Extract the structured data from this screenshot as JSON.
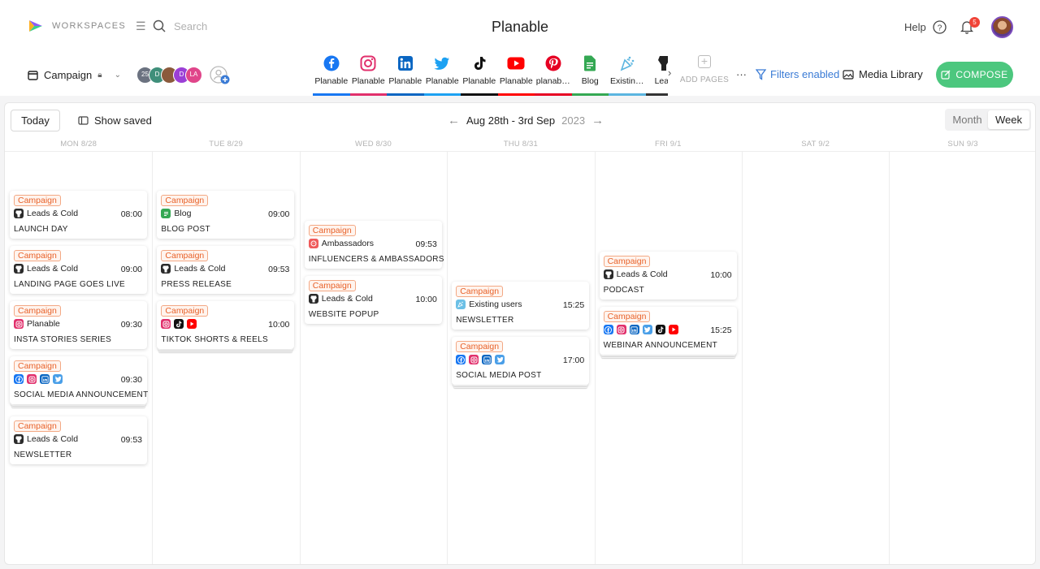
{
  "header": {
    "workspaces_label": "WORKSPACES",
    "search_placeholder": "Search",
    "app_title": "Planable",
    "help_label": "Help",
    "notification_count": "5"
  },
  "toolbar": {
    "campaign_label": "Campaign",
    "avatars": [
      {
        "text": "25",
        "color": "#6b7280"
      },
      {
        "text": "D",
        "color": "#3f8f7a"
      },
      {
        "text": "",
        "color": "#8b5a3c"
      },
      {
        "text": "D",
        "color": "#9b3fd6"
      },
      {
        "text": "LA",
        "color": "#e0458a"
      }
    ],
    "pages": [
      {
        "label": "Planable",
        "icon": "facebook-icon",
        "color": "#1877f2"
      },
      {
        "label": "Planable",
        "icon": "instagram-icon",
        "color": "#e1306c"
      },
      {
        "label": "Planable",
        "icon": "linkedin-icon",
        "color": "#0a66c2"
      },
      {
        "label": "Planable",
        "icon": "twitter-icon",
        "color": "#1da1f2"
      },
      {
        "label": "Planable",
        "icon": "tiktok-icon",
        "color": "#111111"
      },
      {
        "label": "Planable",
        "icon": "youtube-icon",
        "color": "#ff0000"
      },
      {
        "label": "planab…",
        "icon": "pinterest-icon",
        "color": "#e60023"
      },
      {
        "label": "Blog",
        "icon": "blog-icon",
        "color": "#34a853"
      },
      {
        "label": "Existin…",
        "icon": "existing-users-icon",
        "color": "#5bb5e0"
      },
      {
        "label": "Lead",
        "icon": "leads-icon",
        "color": "#333333"
      }
    ],
    "add_pages_label": "ADD PAGES",
    "more_label": "···",
    "filters_label": "Filters enabled",
    "media_library_label": "Media Library",
    "compose_label": "COMPOSE"
  },
  "calendar": {
    "today_label": "Today",
    "show_saved_label": "Show saved",
    "range_label": "Aug 28th - 3rd Sep",
    "range_year": "2023",
    "view_month": "Month",
    "view_week": "Week",
    "days": [
      "MON 8/28",
      "TUE 8/29",
      "WED 8/30",
      "THU 8/31",
      "FRI 9/1",
      "SAT 9/2",
      "SUN 9/3"
    ]
  },
  "posts": [
    {
      "day": 0,
      "tag": "Campaign",
      "account": "Leads & Cold",
      "icons": [
        "leads"
      ],
      "time": "08:00",
      "title": "LAUNCH DAY"
    },
    {
      "day": 0,
      "tag": "Campaign",
      "account": "Leads & Cold",
      "icons": [
        "leads"
      ],
      "time": "09:00",
      "title": "LANDING PAGE GOES LIVE"
    },
    {
      "day": 0,
      "tag": "Campaign",
      "account": "Planable",
      "icons": [
        "instagram"
      ],
      "time": "09:30",
      "title": "INSTA STORIES SERIES"
    },
    {
      "day": 0,
      "tag": "Campaign",
      "account": "",
      "icons": [
        "facebook",
        "instagram",
        "linkedin",
        "twitter"
      ],
      "time": "09:30",
      "title": "SOCIAL MEDIA ANNOUNCEMENT"
    },
    {
      "day": 0,
      "tag": "Campaign",
      "account": "Leads & Cold",
      "icons": [
        "leads"
      ],
      "time": "09:53",
      "title": "NEWSLETTER"
    },
    {
      "day": 1,
      "tag": "Campaign",
      "account": "Blog",
      "icons": [
        "blog"
      ],
      "time": "09:00",
      "title": "BLOG POST"
    },
    {
      "day": 1,
      "tag": "Campaign",
      "account": "Leads & Cold",
      "icons": [
        "leads"
      ],
      "time": "09:53",
      "title": "PRESS RELEASE"
    },
    {
      "day": 1,
      "tag": "Campaign",
      "account": "",
      "icons": [
        "instagram",
        "tiktok",
        "youtube"
      ],
      "time": "10:00",
      "title": "TIKTOK SHORTS & REELS"
    },
    {
      "day": 2,
      "tag": "Campaign",
      "account": "Ambassadors",
      "icons": [
        "ambassadors"
      ],
      "time": "09:53",
      "title": "INFLUENCERS & AMBASSADORS"
    },
    {
      "day": 2,
      "tag": "Campaign",
      "account": "Leads & Cold",
      "icons": [
        "leads"
      ],
      "time": "10:00",
      "title": "WEBSITE POPUP"
    },
    {
      "day": 3,
      "tag": "Campaign",
      "account": "Existing users",
      "icons": [
        "existing"
      ],
      "time": "15:25",
      "title": "NEWSLETTER"
    },
    {
      "day": 3,
      "tag": "Campaign",
      "account": "",
      "icons": [
        "facebook",
        "instagram",
        "linkedin",
        "twitter"
      ],
      "time": "17:00",
      "title": "SOCIAL MEDIA POST"
    },
    {
      "day": 4,
      "tag": "Campaign",
      "account": "Leads & Cold",
      "icons": [
        "leads"
      ],
      "time": "10:00",
      "title": "PODCAST"
    },
    {
      "day": 4,
      "tag": "Campaign",
      "account": "",
      "icons": [
        "facebook",
        "instagram",
        "linkedin",
        "twitter",
        "tiktok",
        "youtube"
      ],
      "time": "15:25",
      "title": "WEBINAR ANNOUNCEMENT"
    }
  ]
}
